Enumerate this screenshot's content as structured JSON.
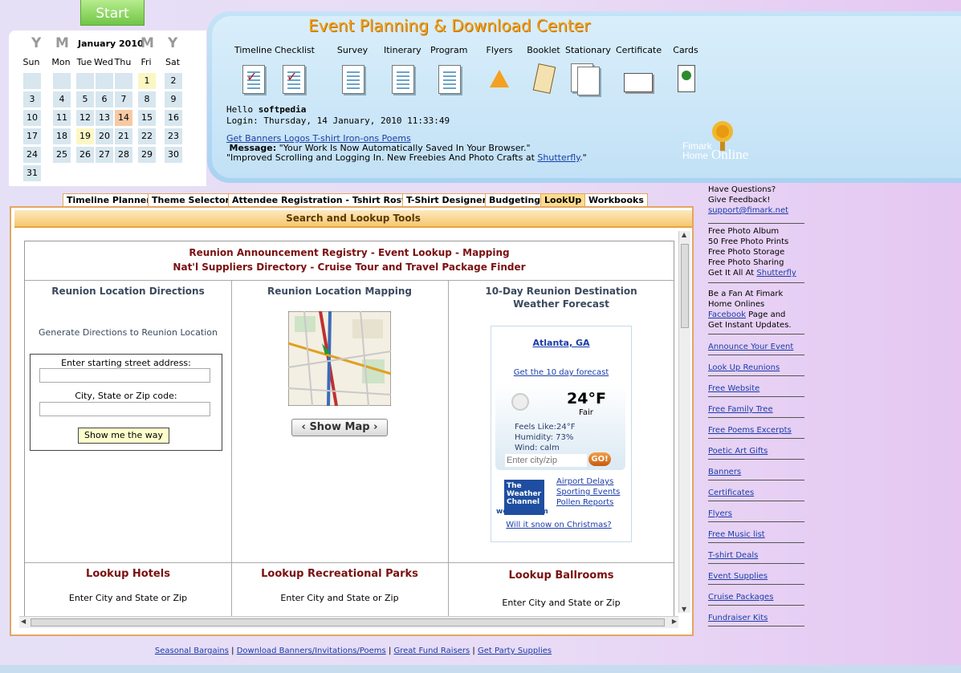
{
  "start_label": "Start",
  "calendar": {
    "nav_prev_year": "Y",
    "nav_prev_month": "M",
    "nav_next_month": "M",
    "nav_next_year": "Y",
    "month_label": "January 2010",
    "weekdays": [
      "Sun",
      "Mon",
      "Tue",
      "Wed",
      "Thu",
      "Fri",
      "Sat"
    ],
    "days": [
      "1",
      "2",
      "3",
      "4",
      "5",
      "6",
      "7",
      "8",
      "9",
      "10",
      "11",
      "12",
      "13",
      "14",
      "15",
      "16",
      "17",
      "18",
      "19",
      "20",
      "21",
      "22",
      "23",
      "24",
      "25",
      "26",
      "27",
      "28",
      "29",
      "30",
      "31"
    ]
  },
  "app_title": "Event Planning & Download Center",
  "toolbar": {
    "items": [
      "Timeline",
      "Checklist",
      "Survey",
      "Itinerary",
      "Program",
      "Flyers",
      "Booklet",
      "Stationary",
      "Certificate",
      "Cards"
    ]
  },
  "greeting": {
    "hello_prefix": "Hello ",
    "username": "softpedia",
    "login_line": "Login: Thursday, 14 January, 2010 11:33:49"
  },
  "promo_link": "Get Banners Logos T-shirt Iron-ons Poems",
  "message": {
    "label": "Message:",
    "text": " \"Your Work Is Now Automatically Saved In Your Browser.\"",
    "line2_prefix": "\"Improved Scrolling and Logging In. New Freebies And Photo Crafts at ",
    "line2_link": "Shutterfly",
    "line2_suffix": ".\""
  },
  "logo_text": {
    "line1": "Fimark",
    "line2": "Home",
    "line3": "Online"
  },
  "tabs": [
    "Timeline Planner",
    "Theme Selector",
    "Attendee Registration - Tshirt Roster",
    "T-Shirt Designer",
    "Budgeting",
    "LookUp",
    "Workbooks"
  ],
  "main": {
    "title": "Search and Lookup Tools",
    "banner_line1": "Reunion Announcement Registry - Event Lookup - Mapping",
    "banner_line2": "Nat'l Suppliers Directory - Cruise Tour and Travel Package Finder",
    "directions": {
      "heading": "Reunion Location Directions",
      "subtitle": "Generate Directions to Reunion Location",
      "start_label": "Enter starting street address:",
      "city_label": "City, State or Zip code:",
      "button": "Show me the way"
    },
    "mapping": {
      "heading": "Reunion Location Mapping",
      "button": "Show Map"
    },
    "weather": {
      "heading_line1": "10-Day Reunion Destination",
      "heading_line2": "Weather Forecast",
      "city": "Atlanta, GA",
      "forecast_link": "Get the 10 day forecast",
      "temp": "24°F",
      "condition": "Fair",
      "feels_like": "Feels Like:24°F",
      "humidity": "Humidity: 73%",
      "wind": "Wind: calm",
      "input_placeholder": "Enter city/zip",
      "go": "GO!",
      "brand_line1": "The",
      "brand_line2": "Weather",
      "brand_line3": "Channel",
      "brand_url": "weather.com",
      "links": [
        "Airport Delays",
        "Sporting Events",
        "Pollen Reports"
      ],
      "snow_link": "Will it snow on Christmas?"
    },
    "hotels": {
      "heading": "Lookup Hotels",
      "label": "Enter City and State or Zip"
    },
    "parks": {
      "heading": "Lookup Recreational Parks",
      "label": "Enter City and State or Zip"
    },
    "ballrooms": {
      "heading": "Lookup Ballrooms",
      "label": "Enter City and State or Zip"
    }
  },
  "sidebar": {
    "questions": [
      "Have Questions?",
      "Give Feedback!"
    ],
    "email": "support@fimark.net",
    "photo_lines": [
      "Free Photo Album",
      "50 Free Photo Prints",
      "Free Photo Storage",
      "Free Photo Sharing"
    ],
    "photo_get_prefix": "Get It All At ",
    "photo_get_link": "Shutterfly",
    "fan_lines": [
      "Be a Fan At Fimark",
      "Home Onlines"
    ],
    "fan_link": "Facebook",
    "fan_suffix": " Page and",
    "fan_last": "Get Instant Updates.",
    "links": [
      "Announce Your Event",
      "Look Up Reunions",
      "Free Website",
      "Free Family Tree",
      "Free Poems Excerpts",
      "Poetic Art Gifts",
      "Banners",
      "Certificates",
      "Flyers",
      "Free Music list",
      "T-shirt Deals",
      "Event Supplies",
      "Cruise Packages",
      "Fundraiser Kits"
    ]
  },
  "footer": {
    "links": [
      "Seasonal Bargains",
      "Download Banners/Invitations/Poems",
      "Great Fund Raisers",
      "Get Party Supplies"
    ],
    "sep": " | "
  },
  "colors": {
    "title": "#f2a01a",
    "tab_border": "#e4a660",
    "active_tab": "#fbdc8e",
    "maroon": "#7a1010",
    "link": "#1a3da8"
  }
}
